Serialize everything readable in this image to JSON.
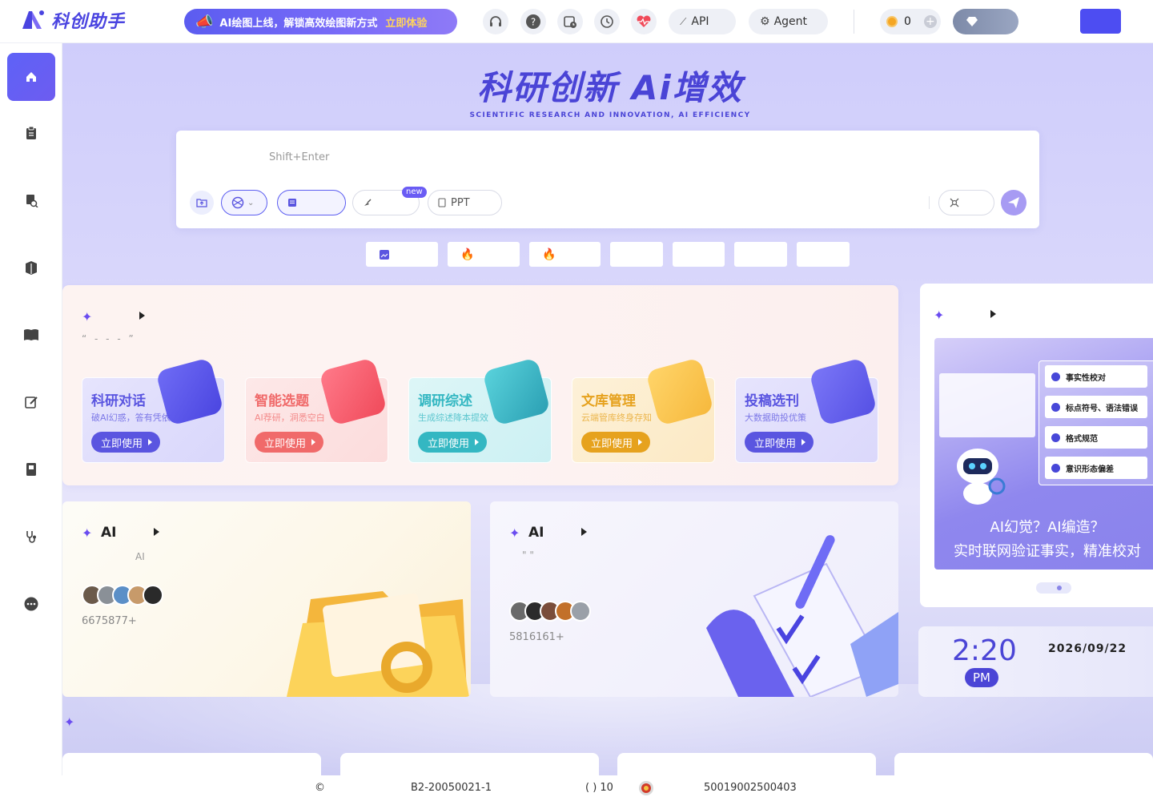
{
  "header": {
    "logo_text": "科创助手",
    "promo_text": "AI绘图上线，解锁高效绘图新方式",
    "promo_cta": "立即体验",
    "icons": [
      "headset-icon",
      "help-icon",
      "calendar-clock-icon",
      "history-icon",
      "heartbeat-icon"
    ],
    "api_label": "API",
    "agent_label": "Agent",
    "coins_value": "0"
  },
  "sidebar": {
    "items": [
      "home-icon",
      "clipboard-icon",
      "research-icon",
      "library-icon",
      "book-icon",
      "edit-icon",
      "manual-icon",
      "stethoscope-icon",
      "more-icon"
    ]
  },
  "hero": {
    "title": "科研创新 Ai增效",
    "subtitle": "SCIENTIFIC RESEARCH AND INNOVATION, AI EFFICIENCY"
  },
  "input": {
    "placeholder": "Shift+Enter",
    "ppt_label": "PPT",
    "new_badge": "new"
  },
  "features": {
    "quote": "“ - - - ”",
    "tools": [
      {
        "title": "科研对话",
        "desc": "破AI幻惑，答有凭依",
        "btn": "立即使用",
        "color": "#5a55e0",
        "bg": "linear-gradient(135deg,#e6e4fd,#d9d7fb)",
        "art": "linear-gradient(135deg,#6f6cf5,#4a45e0)"
      },
      {
        "title": "智能选题",
        "desc": "AI荐研，洞悉空白",
        "btn": "立即使用",
        "color": "#f06a6a",
        "bg": "linear-gradient(135deg,#fde8e8,#fcdcdc)",
        "art": "linear-gradient(135deg,#ff7a8a,#f04a5a)"
      },
      {
        "title": "调研综述",
        "desc": "生成综述降本提效",
        "btn": "立即使用",
        "color": "#34b7c2",
        "bg": "linear-gradient(135deg,#ddf6f7,#ccf0f3)",
        "art": "linear-gradient(135deg,#5ad3dc,#2a9fb3)"
      },
      {
        "title": "文库管理",
        "desc": "云端管库终身存知",
        "btn": "立即使用",
        "color": "#e6a21e",
        "bg": "linear-gradient(135deg,#fdf1d8,#fce9c4)",
        "art": "linear-gradient(135deg,#ffd56a,#f6b83c)"
      },
      {
        "title": "投稿选刊",
        "desc": "大数据助投优策",
        "btn": "立即使用",
        "color": "#5a55e0",
        "bg": "linear-gradient(135deg,#e6e4fd,#dbd8fb)",
        "art": "linear-gradient(135deg,#7b77f7,#5550e4)"
      }
    ]
  },
  "cards": [
    {
      "title": "AI",
      "sub": "AI",
      "count": "6675877+"
    },
    {
      "title": "AI",
      "sub": "\"      \"",
      "count": "5816161+"
    }
  ],
  "banner": {
    "checks": [
      "事实性校对",
      "标点符号、语法错误",
      "格式规范",
      "意识形态偏差"
    ],
    "caption1": "AI幻觉？AI编造？",
    "caption2": "实时联网验证事实，精准校对"
  },
  "clock": {
    "time": "2:20",
    "ampm": "PM",
    "date": "2026/09/22"
  },
  "footer": {
    "copyright": "©",
    "icp": "B2-20050021-1",
    "paren": "(   ) 10",
    "police": "50019002500403"
  }
}
